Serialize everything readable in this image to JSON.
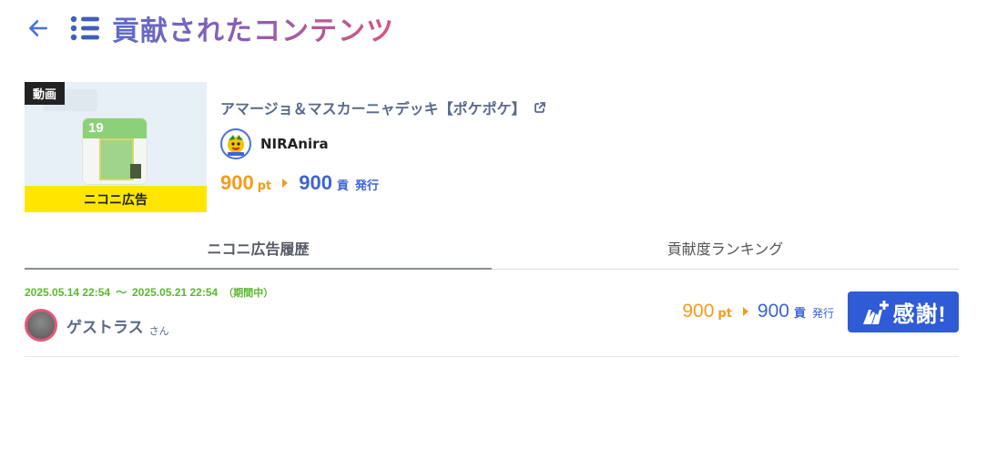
{
  "header": {
    "back_icon": "arrow-left-icon",
    "list_icon": "list-icon",
    "title": "貢献されたコンテンツ",
    "title_gradient": [
      "#5b6cc8",
      "#d9557a"
    ]
  },
  "content": {
    "badge": "動画",
    "thumbnail_number": "19",
    "ad_label": "ニコニ広告",
    "title": "アマージョ＆マスカーニャデッキ【ポケポケ】",
    "creator_name": "NIRAnira",
    "points": "900",
    "points_unit": "pt",
    "contribution": "900",
    "contribution_unit": "貢",
    "issue_label": "発行"
  },
  "tabs": [
    {
      "label": "ニコニ広告履歴",
      "active": true
    },
    {
      "label": "貢献度ランキング",
      "active": false
    }
  ],
  "history": [
    {
      "start": "2025.05.14 22:54",
      "separator": "〜",
      "end": "2025.05.21 22:54",
      "status": "（期間中）",
      "user_name": "ゲストラス",
      "user_suffix": "さん",
      "points": "900",
      "points_unit": "pt",
      "contribution": "900",
      "contribution_unit": "貢",
      "issue_label": "発行",
      "thanks_label": "感謝!"
    }
  ],
  "colors": {
    "accent_blue": "#3d64d6",
    "points_orange": "#f59b1a",
    "period_green": "#5ab82e",
    "ad_yellow": "#ffe600",
    "thanks_button": "#2f5bd6"
  }
}
